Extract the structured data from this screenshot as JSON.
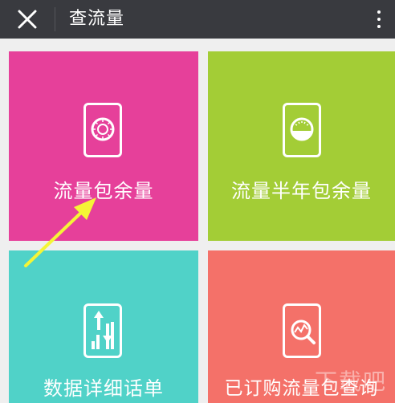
{
  "header": {
    "title": "查流量",
    "close_icon": "close-icon",
    "more_icon": "more-vertical-icon",
    "background": "#393a3f"
  },
  "tiles": [
    {
      "label": "流量包余量",
      "icon": "dial-meter-icon",
      "color": "#e6409a"
    },
    {
      "label": "流量半年包余量",
      "icon": "gauge-icon",
      "color": "#a3cd36"
    },
    {
      "label": "数据详细话单",
      "icon": "bar-chart-updown-icon",
      "color": "#50d2c8"
    },
    {
      "label": "已订购流量包查询",
      "icon": "search-chart-icon",
      "color": "#f47169"
    }
  ],
  "annotation": {
    "arrow_color": "#f5f536",
    "icon": "pointer-arrow-icon"
  },
  "watermark": "下载吧"
}
